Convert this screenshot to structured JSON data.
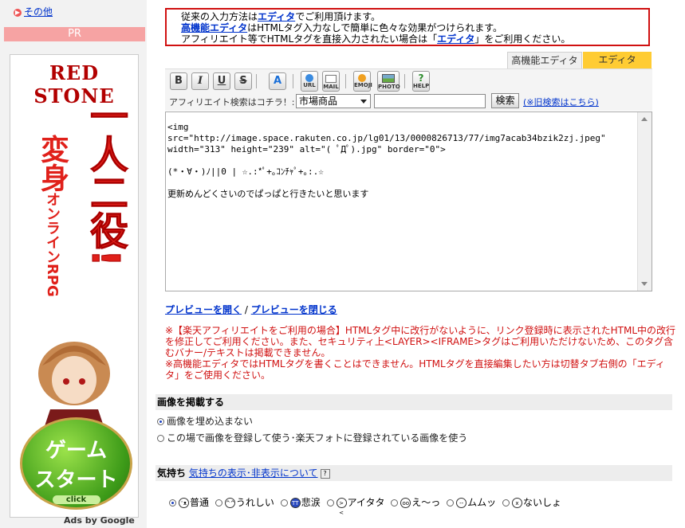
{
  "sidebar": {
    "other_link": "その他",
    "pr_label": "PR",
    "ad": {
      "logo": "RED STONE",
      "title": "一人二役!",
      "subtitle": "変身",
      "subtitle2": "オンラインRPG",
      "start_line1": "ゲーム",
      "start_line2": "スタート",
      "start_click": "click"
    },
    "ads_by": "Ads by Google"
  },
  "notice": {
    "line1_prefix": "従来の入力方法は",
    "line1_link": "エディタ",
    "line1_suffix": "でご利用頂けます。",
    "line2_link": "高機能エディタ",
    "line2_suffix": "はHTMLタグ入力なしで簡単に色々な効果がつけられます。",
    "line3_prefix": "アフィリエイト等でHTMLタグを直接入力されたい場合は「",
    "line3_link": "エディタ",
    "line3_suffix": "」をご利用ください。"
  },
  "tabs": {
    "advanced": "高機能エディタ",
    "editor": "エディタ"
  },
  "toolbar": {
    "bold": "B",
    "italic": "I",
    "underline": "U",
    "strike": "S",
    "font": "A",
    "url": "URL",
    "mail": "MAIL",
    "emoji": "EMOJI",
    "photo": "PHOTO",
    "help": "HELP"
  },
  "affiliate": {
    "label": "アフィリエイト検索はコチラ！:",
    "select_value": "市場商品",
    "search_button": "検索",
    "old_search": "(※旧検索はこちら)"
  },
  "editor": {
    "content": "<img\nsrc=\"http://image.space.rakuten.co.jp/lg01/13/0000826713/77/img7acab34bzik2zj.jpeg\"\nwidth=\"313\" height=\"239\" alt=\"( ﾟДﾟ).jpg\" border=\"0\">\n\n(*・∀・)ﾉ||0 | ☆.:*ﾟ+｡ｺﾝﾁｬﾟ+｡:.☆\n\n更新めんどくさいのでぱっぱと行きたいと思います"
  },
  "preview": {
    "open": "プレビューを開く",
    "separator": "/",
    "close": "プレビューを閉じる"
  },
  "red_note": {
    "text": "※【楽天アフィリエイトをご利用の場合】HTMLタグ中に改行がないように、リンク登録時に表示されたHTML中の改行を修正してご利用ください。また、セキュリティ上<LAYER><IFRAME>タグはご利用いただけないため、このタグ含むバナー/テキストは掲載できません。\n※高機能エディタではHTMLタグを書くことはできません。HTMLタグを直接編集したい方は切替タブ右側の「エディタ」をご使用ください。"
  },
  "image_section": {
    "header": "画像を掲載する",
    "option1": "画像を埋め込まない",
    "option2": "この場で画像を登録して使う･楽天フォトに登録されている画像を使う"
  },
  "mood_section": {
    "header": "気持ち",
    "link": "気持ちの表示･非表示について",
    "help": "?",
    "moods": [
      "普通",
      "うれしい",
      "悲涙",
      "アイタタ",
      "え～っ",
      "ムムッ",
      "ないしょ"
    ]
  }
}
